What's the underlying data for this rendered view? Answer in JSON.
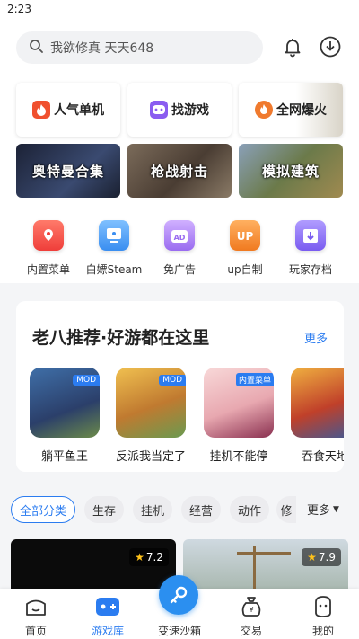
{
  "status_bar": {
    "time": "2:23"
  },
  "search": {
    "placeholder": "我欲修真 天天648"
  },
  "featured_tiles": [
    {
      "label": "人气单机",
      "icon": "flame-icon",
      "color": "#f0502e"
    },
    {
      "label": "找游戏",
      "icon": "gamepad-icon",
      "color": "#8a5cf0"
    },
    {
      "label": "全网爆火",
      "icon": "fire-icon",
      "color": "#f07a2e"
    }
  ],
  "banners": [
    {
      "label": "奥特曼合集",
      "color": "#2a3550"
    },
    {
      "label": "枪战射击",
      "color": "#5a4a3e"
    },
    {
      "label": "模拟建筑",
      "color": "#6a7a4a"
    }
  ],
  "quick_entries": [
    {
      "label": "内置菜单",
      "icon": "menu-icon",
      "color": "#f25a4a"
    },
    {
      "label": "白嫖Steam",
      "icon": "monitor-icon",
      "color": "#4a9cf0"
    },
    {
      "label": "免广告",
      "icon": "ad-block-icon",
      "color": "#a97cf0"
    },
    {
      "label": "up自制",
      "icon": "up-icon",
      "color": "#f08a2e"
    },
    {
      "label": "玩家存档",
      "icon": "save-icon",
      "color": "#8a6cf0"
    }
  ],
  "recommend": {
    "title": "老八推荐·好游都在这里",
    "more": "更多",
    "games": [
      {
        "name": "躺平鱼王",
        "badge": "MOD"
      },
      {
        "name": "反派我当定了",
        "badge": "MOD"
      },
      {
        "name": "挂机不能停",
        "badge": "内置菜单"
      },
      {
        "name": "吞食天地",
        "badge": ""
      }
    ]
  },
  "categories": {
    "items": [
      "全部分类",
      "生存",
      "挂机",
      "经营",
      "动作",
      "修"
    ],
    "active": "全部分类",
    "more": "更多"
  },
  "list_previews": [
    {
      "rating": "7.2"
    },
    {
      "rating": "7.9"
    }
  ],
  "bottom_nav": {
    "items": [
      "首页",
      "游戏库",
      "变速沙箱",
      "交易",
      "我的"
    ],
    "active": "游戏库"
  },
  "colors": {
    "accent": "#2b7cf0"
  }
}
